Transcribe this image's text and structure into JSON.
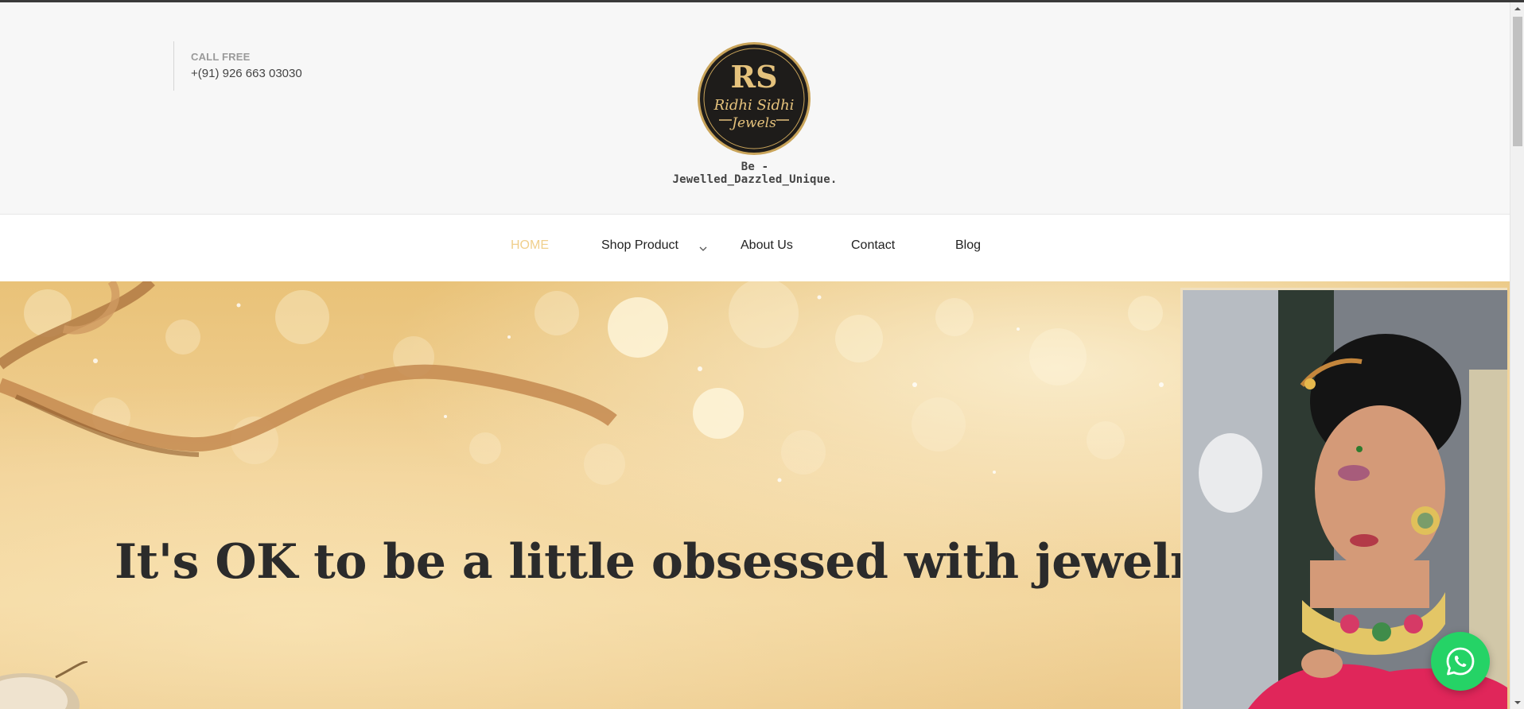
{
  "header": {
    "call_label": "CALL FREE",
    "call_number": "+(91) 926 663 03030",
    "logo_text_line1": "Ridhi Sidhi",
    "logo_text_line2": "Jewels",
    "logo_monogram": "RS",
    "tagline": "Be - Jewelled_Dazzled_Unique."
  },
  "nav": {
    "items": [
      {
        "label": "HOME",
        "active": true
      },
      {
        "label": "Shop Product",
        "has_dropdown": true
      },
      {
        "label": "About Us"
      },
      {
        "label": "Contact"
      },
      {
        "label": "Blog"
      }
    ]
  },
  "hero": {
    "title": "It's OK to be a little obsessed with jewelry"
  },
  "floating": {
    "whatsapp_icon": "whatsapp-icon"
  },
  "colors": {
    "accent_gold": "#f0cf8c",
    "whatsapp_green": "#25d366",
    "hero_gold": "#f1d196"
  }
}
